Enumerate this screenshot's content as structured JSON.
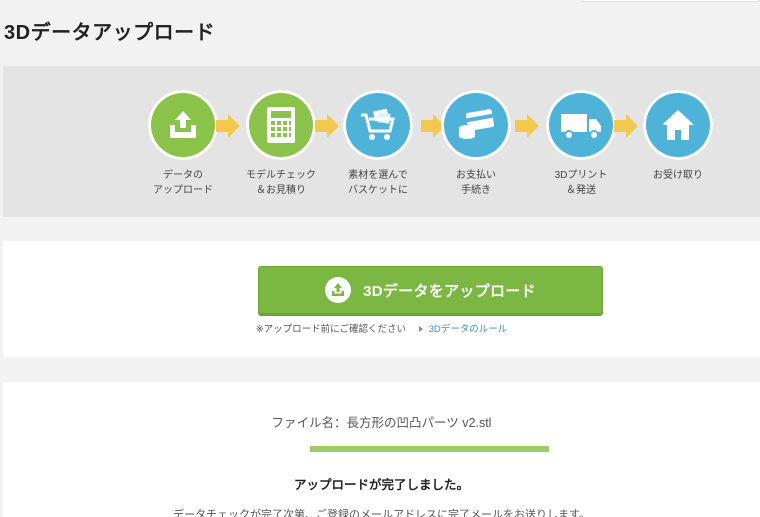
{
  "page": {
    "title": "3Dデータアップロード"
  },
  "steps": [
    {
      "label": "データの\nアップロード",
      "icon": "upload-tray-icon",
      "color": "#8bc34a"
    },
    {
      "label": "モデルチェック\n＆お見積り",
      "icon": "calculator-icon",
      "color": "#8bc34a"
    },
    {
      "label": "素材を選んで\nバスケットに",
      "icon": "shopping-cart-icon",
      "color": "#4fb3d9"
    },
    {
      "label": "お支払い\n手続き",
      "icon": "payment-card-icon",
      "color": "#4fb3d9"
    },
    {
      "label": "3Dプリント\n＆発送",
      "icon": "delivery-truck-icon",
      "color": "#4fb3d9"
    },
    {
      "label": "お受け取り",
      "icon": "home-icon",
      "color": "#4fb3d9"
    }
  ],
  "upload": {
    "button_label": "3Dデータをアップロード",
    "notice_text": "※アップロード前にご確認ください",
    "rule_link": "3Dデータのルール"
  },
  "result": {
    "filename_text": "ファイル名：長方形の凹凸パーツ v2.stl",
    "progress": 1.0,
    "complete_text": "アップロードが完了しました。",
    "sub_text": "データチェックが完了次第、ご登録のメールアドレスに完了メールをお送りします。"
  },
  "colors": {
    "accent_green": "#7cb744",
    "accent_blue": "#4fb3d9",
    "arrow_yellow": "#f2c94c",
    "link_blue": "#3a8fc4"
  }
}
